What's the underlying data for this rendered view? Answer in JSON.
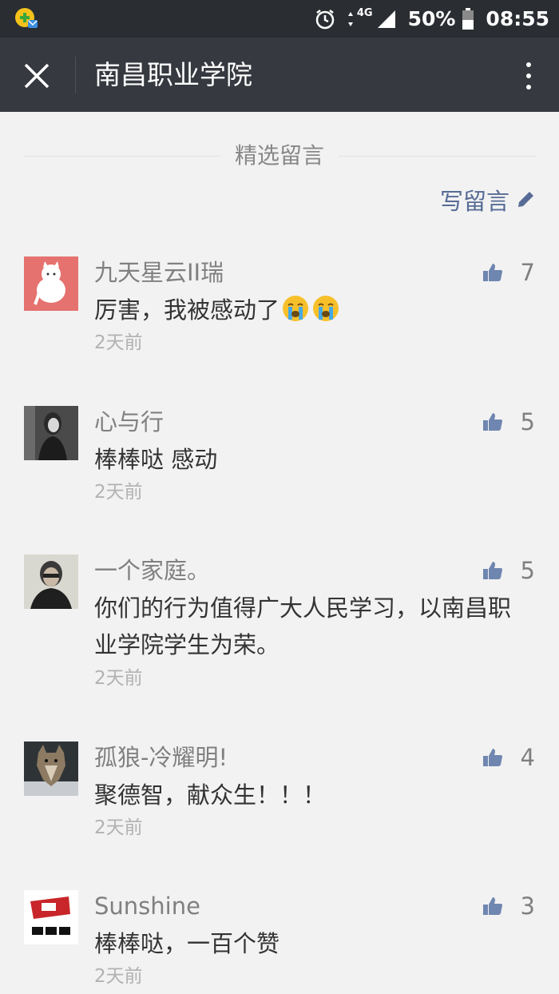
{
  "status_bar": {
    "network": "4G",
    "battery": "50%",
    "time": "08:55"
  },
  "titlebar": {
    "title": "南昌职业学院"
  },
  "section": {
    "heading": "精选留言",
    "write_label": "写留言"
  },
  "comments": [
    {
      "name": "九天星云II瑞",
      "likes": "7",
      "text": "厉害，我被感动了",
      "emoji_count": 2,
      "time": "2天前"
    },
    {
      "name": "心与行",
      "likes": "5",
      "text": "棒棒哒 感动",
      "time": "2天前"
    },
    {
      "name": "一个家庭。",
      "likes": "5",
      "text": "你们的行为值得广大人民学习，以南昌职业学院学生为荣。",
      "time": "2天前"
    },
    {
      "name": "孤狼-冷耀明!",
      "likes": "4",
      "text": "聚德智，献众生！！！",
      "time": "2天前"
    },
    {
      "name": "Sunshine",
      "likes": "3",
      "text": "棒棒哒，一百个赞",
      "time": "2天前"
    }
  ],
  "colors": {
    "status_bar": "#2a2d32",
    "title_bar": "#36393f",
    "background": "#f2f2f2",
    "link": "#576b95",
    "like_icon": "#6f86b0"
  }
}
